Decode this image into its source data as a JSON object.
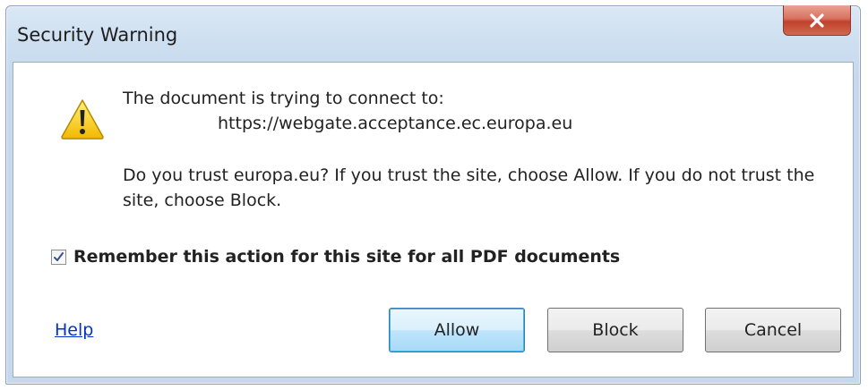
{
  "window": {
    "title": "Security Warning"
  },
  "icons": {
    "close": "close-icon",
    "warning": "warning-icon",
    "check": "checkmark-icon"
  },
  "message": {
    "line1": "The document is trying to connect to:",
    "url": "https://webgate.acceptance.ec.europa.eu",
    "trust_prompt": "Do you trust europa.eu? If you trust the site, choose Allow. If you do not trust the site, choose Block."
  },
  "remember": {
    "label": "Remember this action for this site for all PDF documents",
    "checked": true
  },
  "help": {
    "label": "Help"
  },
  "buttons": {
    "allow": "Allow",
    "block": "Block",
    "cancel": "Cancel"
  },
  "colors": {
    "link": "#0033cc",
    "close_button": "#c0412c",
    "default_button_border": "#3c7fb1",
    "warning_yellow": "#f5c400"
  }
}
